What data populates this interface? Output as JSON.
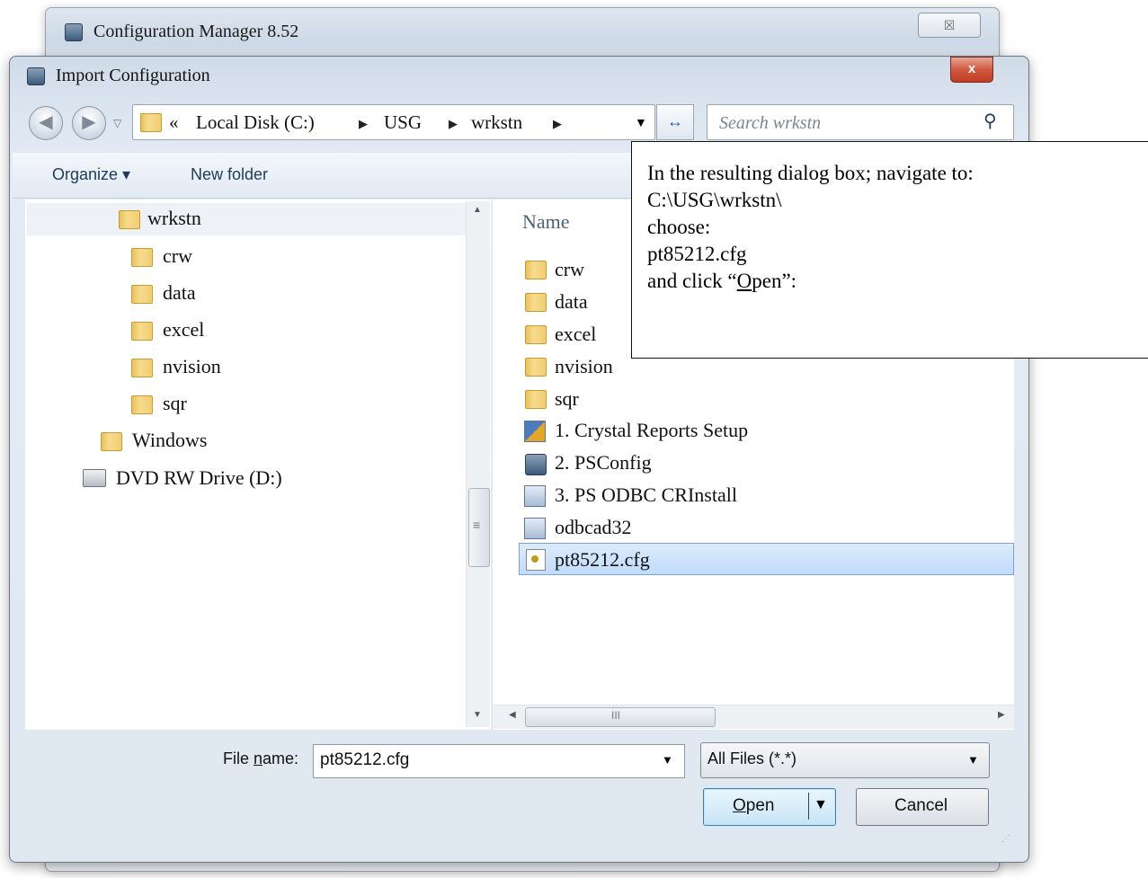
{
  "background_window": {
    "title": "Configuration Manager 8.52",
    "close_glyph": "☒"
  },
  "dialog": {
    "title": "Import Configuration",
    "close_glyph": "x"
  },
  "nav": {
    "breadcrumb_prefix": "«",
    "crumbs": [
      "Local Disk (C:)",
      "USG",
      "wrkstn"
    ],
    "search_placeholder": "Search wrkstn"
  },
  "toolbar": {
    "organize": "Organize ▾",
    "new_folder": "New folder"
  },
  "tree": {
    "items": [
      {
        "label": "wrkstn",
        "icon": "folder-icon"
      },
      {
        "label": "crw",
        "icon": "folder-icon"
      },
      {
        "label": "data",
        "icon": "folder-icon"
      },
      {
        "label": "excel",
        "icon": "folder-icon"
      },
      {
        "label": "nvision",
        "icon": "folder-icon"
      },
      {
        "label": "sqr",
        "icon": "folder-icon"
      },
      {
        "label": "Windows",
        "icon": "folder-icon"
      },
      {
        "label": "DVD RW Drive (D:)",
        "icon": "dvd-drive-icon"
      }
    ]
  },
  "files": {
    "column_name": "Name",
    "items": [
      {
        "label": "crw",
        "icon": "folder-icon"
      },
      {
        "label": "data",
        "icon": "folder-icon"
      },
      {
        "label": "excel",
        "icon": "folder-icon"
      },
      {
        "label": "nvision",
        "icon": "folder-icon"
      },
      {
        "label": "sqr",
        "icon": "folder-icon"
      },
      {
        "label": "1. Crystal Reports Setup",
        "icon": "shortcut-icon"
      },
      {
        "label": "2. PSConfig",
        "icon": "psconfig-icon"
      },
      {
        "label": "3. PS ODBC CRInstall",
        "icon": "shortcut-icon"
      },
      {
        "label": "odbcad32",
        "icon": "shortcut-icon"
      },
      {
        "label": "pt85212.cfg",
        "icon": "cfg-file-icon",
        "selected": true
      }
    ],
    "hscroll_grip": "III",
    "vscroll_grip": "≡"
  },
  "bottom": {
    "filename_label_pre": "File ",
    "filename_label_u": "n",
    "filename_label_post": "ame:",
    "filename_value": "pt85212.cfg",
    "filter_value": "All Files (*.*)",
    "open_u": "O",
    "open_rest": "pen",
    "cancel": "Cancel"
  },
  "callout": {
    "line1": "In the resulting dialog box; navigate to:",
    "line2": "C:\\USG\\wrkstn\\",
    "line3": "choose:",
    "line4": "pt85212.cfg",
    "line5_pre": "and click “",
    "line5_u": "O",
    "line5_post": "pen”:"
  },
  "colors": {
    "selection": "#cce8ff",
    "accent": "#3c7fb1",
    "close_red": "#c94a30"
  }
}
